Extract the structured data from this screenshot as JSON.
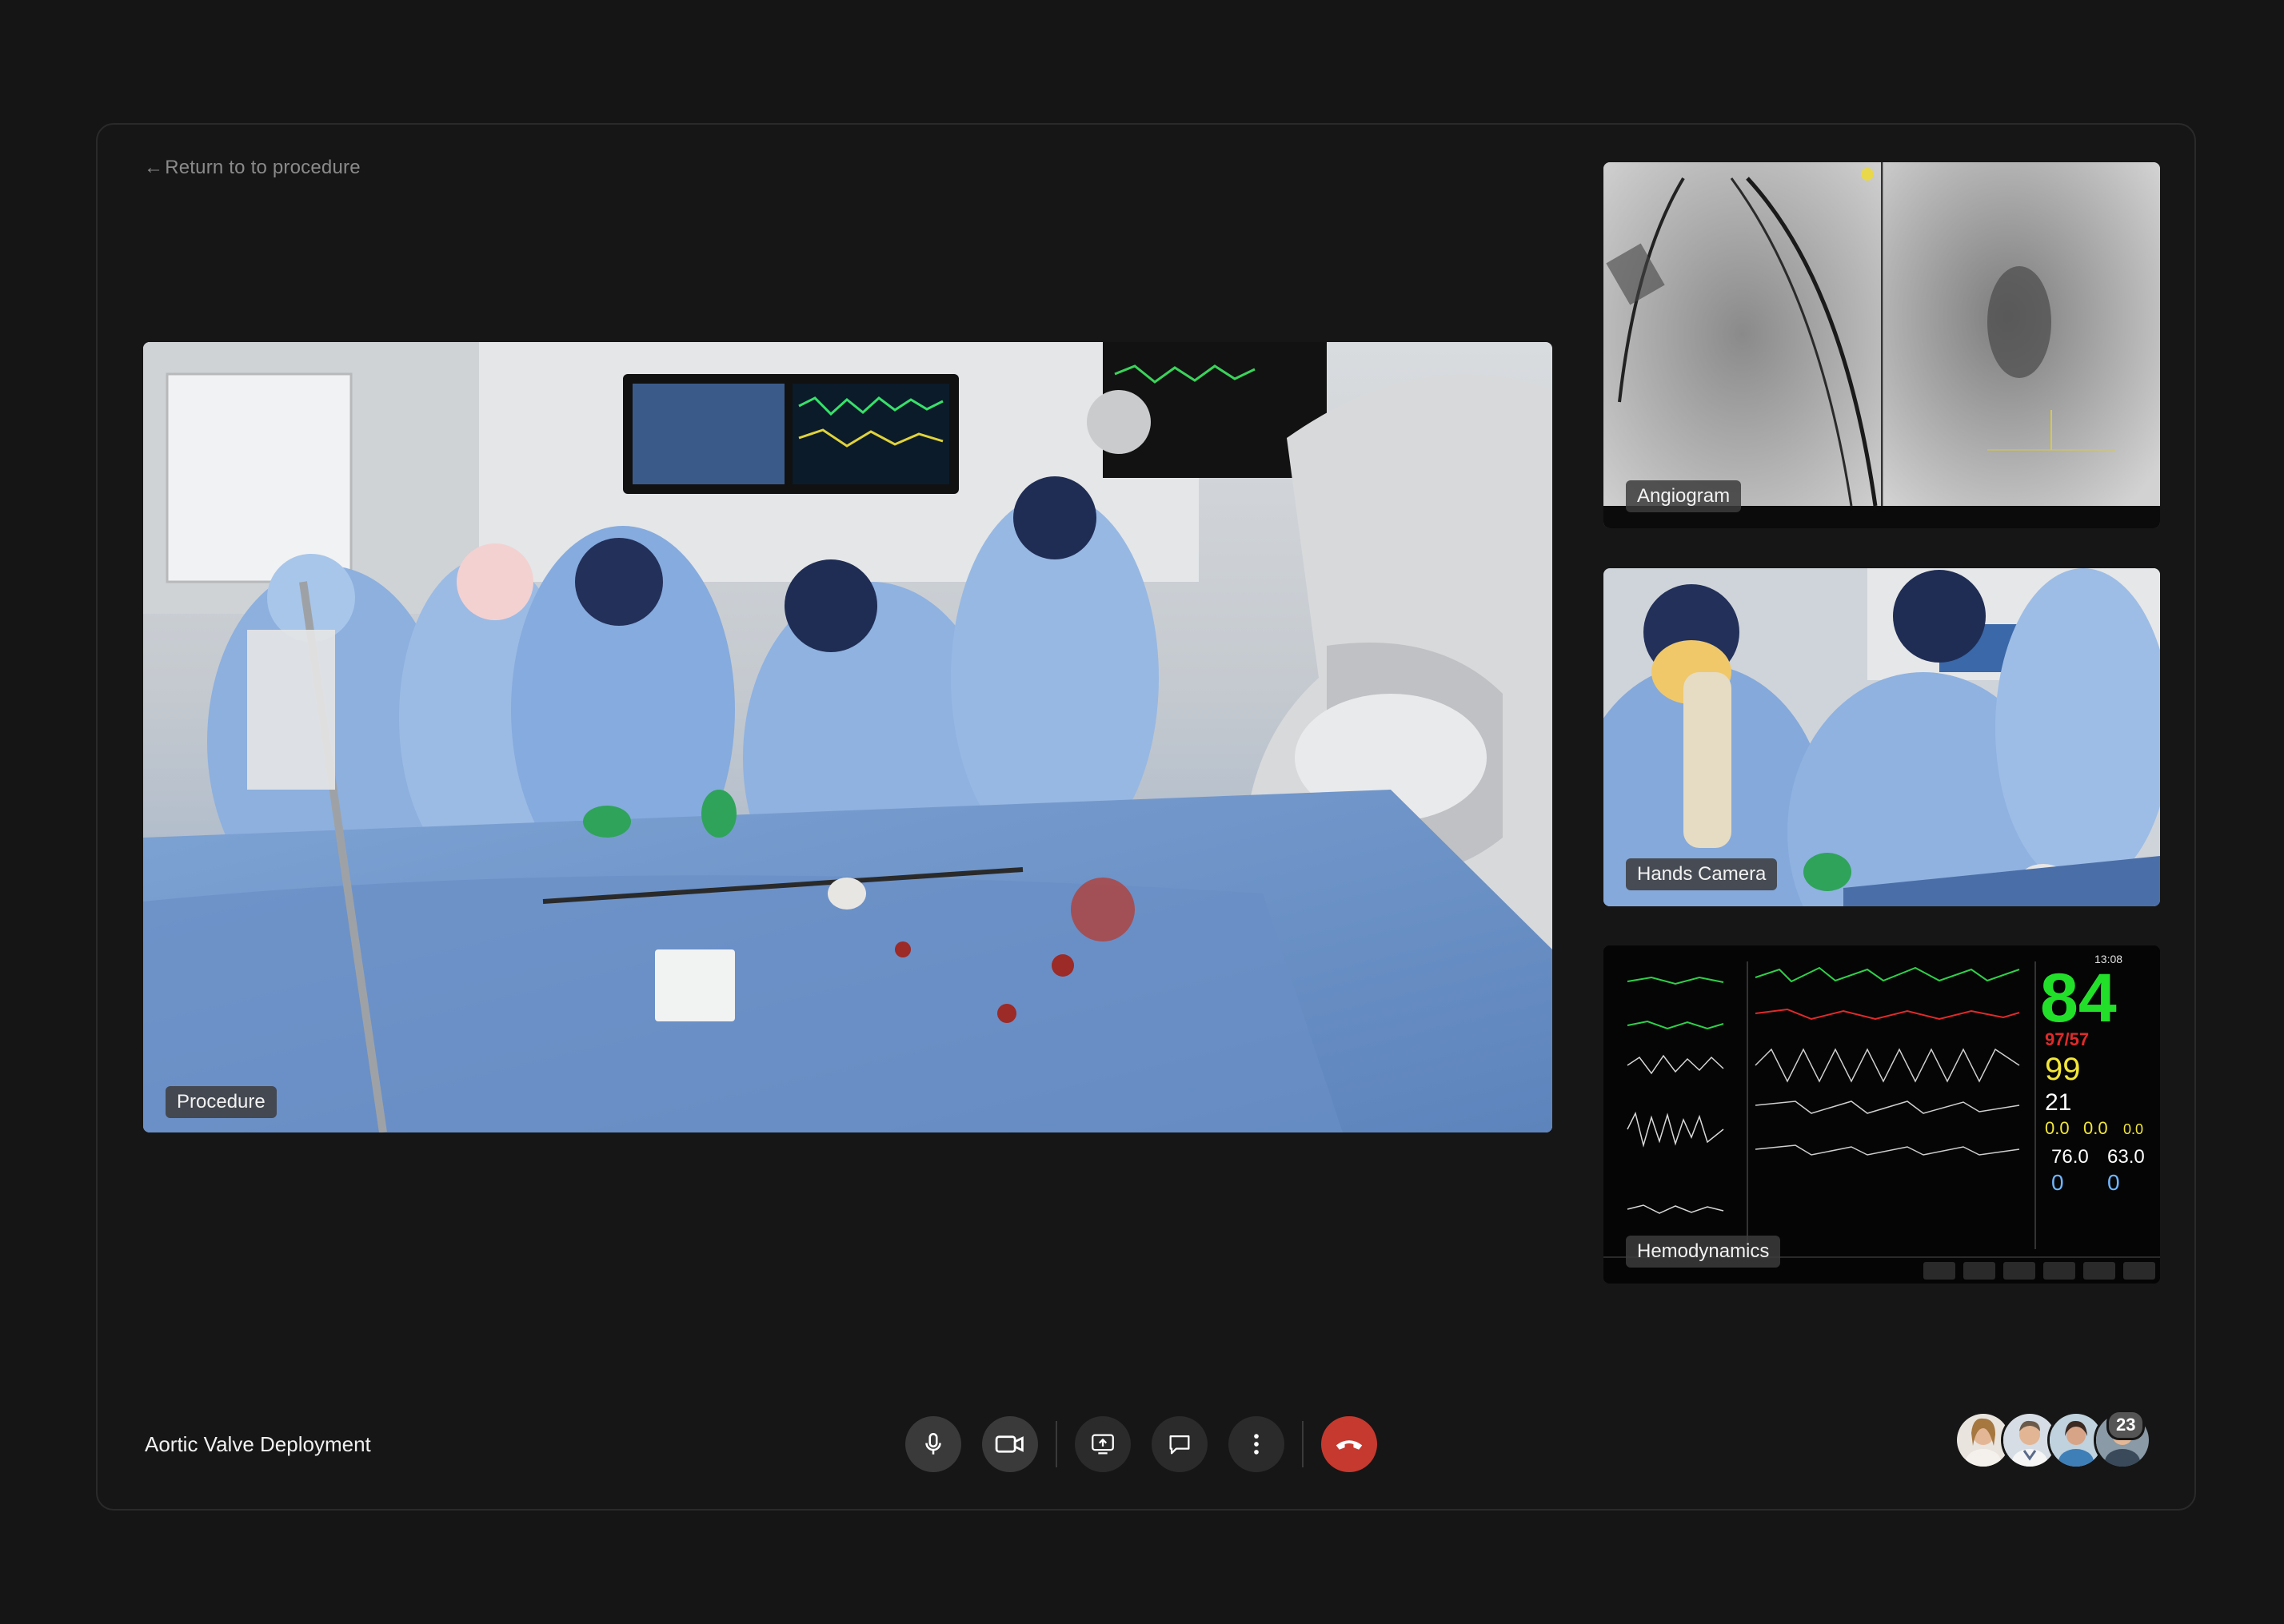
{
  "nav": {
    "back_label": "Return to to procedure"
  },
  "tiles": {
    "main": {
      "label": "Procedure"
    },
    "angiogram": {
      "label": "Angiogram"
    },
    "hands": {
      "label": "Hands Camera"
    },
    "hemodynamics": {
      "label": "Hemodynamics",
      "monitor": {
        "time": "13:08",
        "heart_rate": "84",
        "blood_pressure": "97/57",
        "spo2": "99",
        "resp": "21",
        "val_a": "0.0",
        "val_b": "0.0",
        "val_c": "0.0",
        "val_d": "76.0",
        "val_e": "63.0",
        "val_f": "0",
        "val_g": "0"
      }
    }
  },
  "call": {
    "title": "Aortic Valve Deployment",
    "participant_count": "23",
    "controls": [
      "microphone-icon",
      "camera-icon",
      "screen-share-icon",
      "chat-icon",
      "more-icon",
      "end-call-icon"
    ]
  },
  "colors": {
    "background": "#151515",
    "end_call": "#c6392f",
    "monitor_green": "#22e02a",
    "monitor_yellow": "#f2e63a",
    "monitor_blue": "#6fb6ff",
    "monitor_red": "#e02a2a"
  }
}
